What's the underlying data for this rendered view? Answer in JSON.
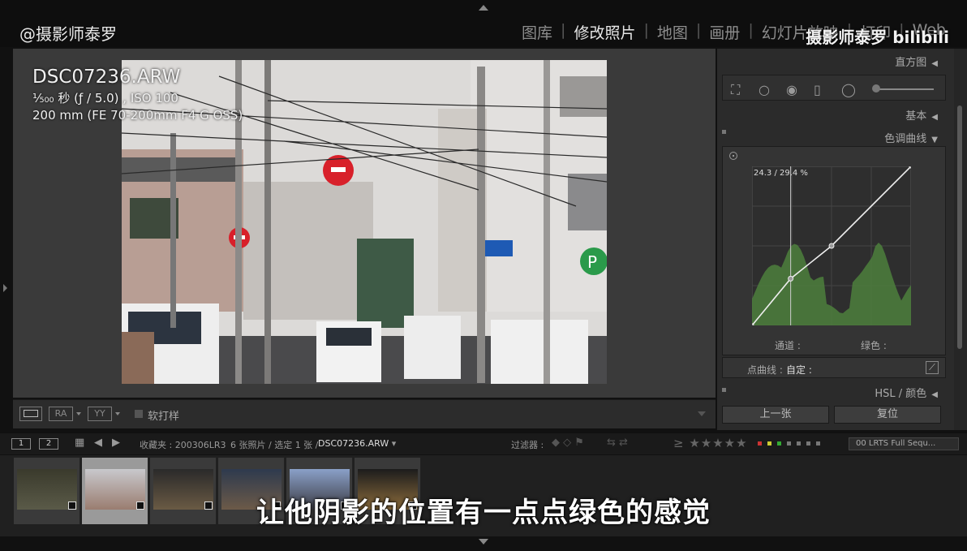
{
  "watermark": {
    "left": "@摄影师泰罗",
    "right": "摄影师泰罗 bilibili"
  },
  "modules": [
    "图库",
    "修改照片",
    "地图",
    "画册",
    "幻灯片放映",
    "打印",
    "Web"
  ],
  "photo_info": {
    "filename": "DSC07236.ARW",
    "exposure": "¹⁄₅₀₀ 秒 (ƒ / 5.0) , ISO 100",
    "lens": "200 mm (FE 70-200mm F4 G OSS)"
  },
  "toolbar": {
    "view_ra": "RA",
    "view_yy": "YY",
    "softproof_label": "软打样"
  },
  "panel": {
    "histogram_label": "直方图",
    "basic_label": "基本",
    "tone_curve_label": "色调曲线",
    "coord_readout": "24.3 / 29.4 %",
    "channel_label": "通道 :",
    "channel_value": "绿色 :",
    "point_curve_label": "点曲线 :",
    "point_curve_value": "自定 :",
    "hsl_label": "HSL / 颜色",
    "prev_button": "上一张",
    "reset_button": "复位",
    "curve_color": "#eeeeee",
    "histogram_color": "#4c7f3c",
    "curve_points": [
      [
        0,
        0
      ],
      [
        24.3,
        29.4
      ],
      [
        50,
        50
      ],
      [
        100,
        100
      ]
    ]
  },
  "filmbar": {
    "box1": "1",
    "box2": "2",
    "collection": "收藏夹 : 200306LR3",
    "count": "6 张照片 / 选定 1 张 /",
    "current": "DSC07236.ARW",
    "filter_label": "过滤器 :",
    "stars": "≥ ★★★★★",
    "preset": "00 LRTS Full Sequ..."
  },
  "filmstrip": {
    "thumbs": [
      {
        "colors": [
          "#3a3a2c",
          "#5a5a48"
        ]
      },
      {
        "colors": [
          "#c8c8cc",
          "#9a7d70"
        ]
      },
      {
        "colors": [
          "#2a2a2a",
          "#6a5a44"
        ]
      },
      {
        "colors": [
          "#2e3a4e",
          "#6c5a48"
        ]
      },
      {
        "colors": [
          "#8aa0c8",
          "#3c3c44"
        ]
      },
      {
        "colors": [
          "#1c1c1c",
          "#8c6c3c"
        ]
      }
    ]
  },
  "subtitle": "让他阴影的位置有一点点绿色的感觉"
}
